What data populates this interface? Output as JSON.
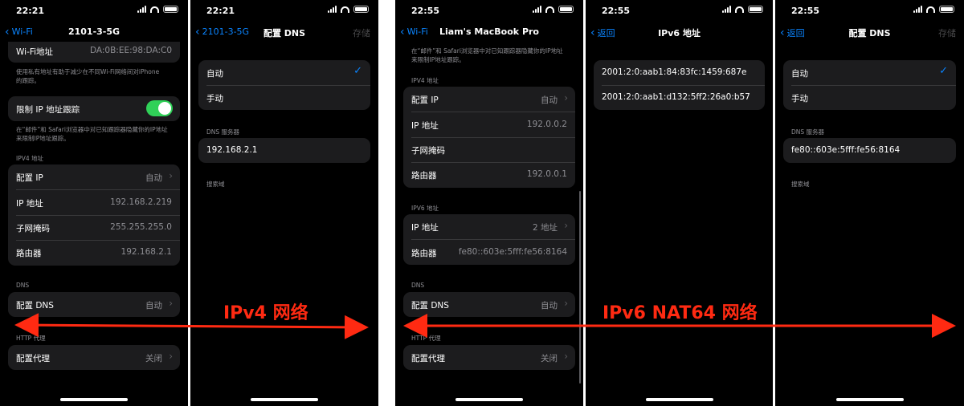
{
  "status": {
    "time1": "22:21",
    "time2": "22:55"
  },
  "panel1": {
    "back": "Wi-Fi",
    "title": "2101-3-5G",
    "wifi_addr_label": "Wi-Fi地址",
    "wifi_addr_value": "DA:0B:EE:98:DA:C0",
    "wifi_note": "使用私有地址有助于减少在不同Wi-Fi网络间对iPhone的跟踪。",
    "limit_ip_label": "限制 IP 地址跟踪",
    "limit_note": "在“邮件”和 Safari浏览器中对已知跟踪器隐藏你的IP地址来限制IP地址跟踪。",
    "ipv4_header": "IPV4 地址",
    "config_ip_label": "配置 IP",
    "config_ip_value": "自动",
    "ip_label": "IP 地址",
    "ip_value": "192.168.2.219",
    "mask_label": "子网掩码",
    "mask_value": "255.255.255.0",
    "router_label": "路由器",
    "router_value": "192.168.2.1",
    "dns_header": "DNS",
    "config_dns_label": "配置 DNS",
    "config_dns_value": "自动",
    "http_header": "HTTP 代理",
    "proxy_label": "配置代理",
    "proxy_value": "关闭"
  },
  "panel2": {
    "back": "2101-3-5G",
    "title": "配置 DNS",
    "save": "存储",
    "auto_label": "自动",
    "manual_label": "手动",
    "dns_servers_header": "DNS 服务器",
    "dns_server": "192.168.2.1",
    "search_domain_header": "搜索域"
  },
  "panel3": {
    "back": "Wi-Fi",
    "title": "Liam's MacBook Pro",
    "top_note": "在“邮件”和 Safari浏览器中对已知跟踪器隐藏你的IP地址来限制IP地址跟踪。",
    "ipv4_header": "IPV4 地址",
    "config_ip_label": "配置 IP",
    "config_ip_value": "自动",
    "ip_label": "IP 地址",
    "ip_value": "192.0.0.2",
    "mask_label": "子网掩码",
    "router_label": "路由器",
    "router_value": "192.0.0.1",
    "ipv6_header": "IPV6 地址",
    "ipv6_label": "IP 地址",
    "ipv6_value": "2 地址",
    "router6_label": "路由器",
    "router6_value": "fe80::603e:5fff:fe56:8164",
    "dns_header": "DNS",
    "config_dns_label": "配置 DNS",
    "config_dns_value": "自动",
    "http_header": "HTTP 代理",
    "proxy_label": "配置代理",
    "proxy_value": "关闭"
  },
  "panel4": {
    "back": "返回",
    "title": "IPv6 地址",
    "addr1": "2001:2:0:aab1:84:83fc:1459:687e",
    "addr2": "2001:2:0:aab1:d132:5ff2:26a0:b57"
  },
  "panel5": {
    "back": "返回",
    "title": "配置 DNS",
    "save": "存储",
    "auto_label": "自动",
    "manual_label": "手动",
    "dns_servers_header": "DNS 服务器",
    "dns_server": "fe80::603e:5fff:fe56:8164",
    "search_domain_header": "搜索域"
  },
  "captions": {
    "ipv4": "IPv4 网络",
    "ipv6": "IPv6 NAT64 网络"
  },
  "colors": {
    "accent": "#0a84ff",
    "toggle": "#30d158",
    "annotation": "#ff2a12"
  }
}
